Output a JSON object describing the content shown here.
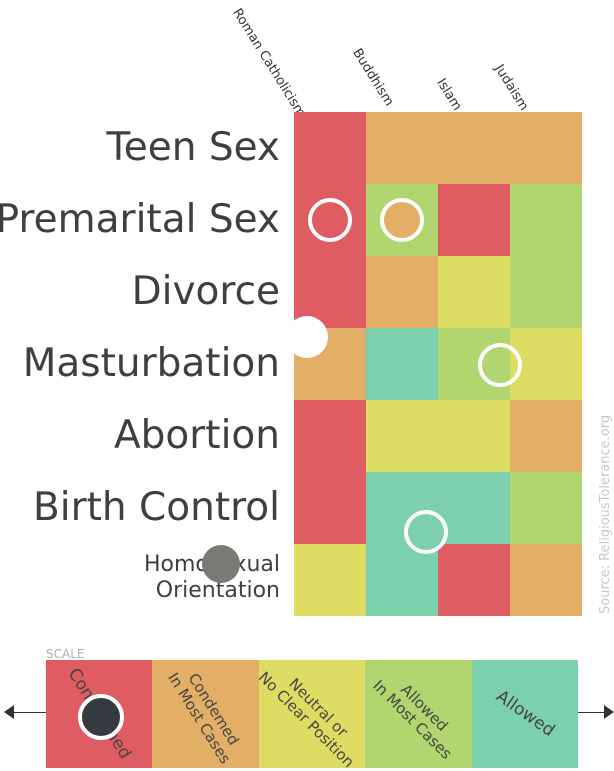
{
  "chart_data": {
    "type": "heatmap",
    "columns": [
      "Roman Catholicism",
      "Buddhism",
      "Islam",
      "Judaism"
    ],
    "rows": [
      {
        "label": "Teen Sex",
        "values": [
          0,
          1,
          1,
          1
        ]
      },
      {
        "label": "Premarital Sex",
        "values": [
          0,
          3,
          0,
          3
        ]
      },
      {
        "label": "Divorce",
        "values": [
          0,
          1,
          2,
          3
        ]
      },
      {
        "label": "Masturbation",
        "values": [
          1,
          4,
          3,
          2
        ]
      },
      {
        "label": "Abortion",
        "values": [
          0,
          2,
          2,
          1
        ]
      },
      {
        "label": "Birth Control",
        "values": [
          0,
          4,
          4,
          3
        ]
      },
      {
        "label_lines": [
          "Homosexual",
          "Orientation"
        ],
        "values": [
          2,
          4,
          0,
          1
        ]
      }
    ],
    "source": "Source: ReligiousTolerance.org",
    "scale_title": "SCALE",
    "scale": [
      {
        "level": 0,
        "lines": [
          "Condemned"
        ],
        "color": "#e05c63"
      },
      {
        "level": 1,
        "lines": [
          "Condemed",
          "In Most Cases"
        ],
        "color": "#e3ae66"
      },
      {
        "level": 2,
        "lines": [
          "Neutral or",
          "No Clear Position"
        ],
        "color": "#dedd63"
      },
      {
        "level": 3,
        "lines": [
          "Allowed",
          "In Most Cases"
        ],
        "color": "#b1d56f"
      },
      {
        "level": 4,
        "lines": [
          "Allowed"
        ],
        "color": "#7dd0ad"
      }
    ]
  }
}
